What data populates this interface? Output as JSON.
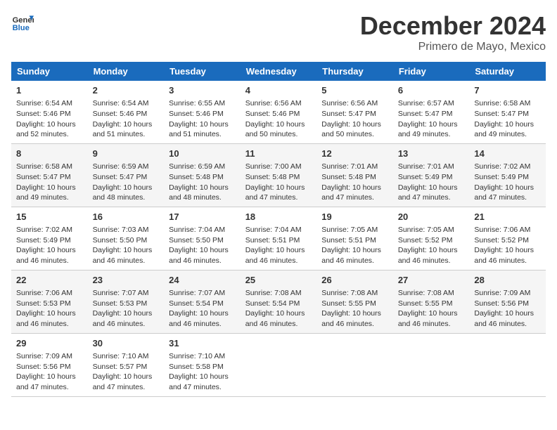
{
  "logo": {
    "line1": "General",
    "line2": "Blue"
  },
  "title": "December 2024",
  "location": "Primero de Mayo, Mexico",
  "headers": [
    "Sunday",
    "Monday",
    "Tuesday",
    "Wednesday",
    "Thursday",
    "Friday",
    "Saturday"
  ],
  "weeks": [
    [
      {
        "day": "1",
        "sunrise": "6:54 AM",
        "sunset": "5:46 PM",
        "daylight": "10 hours and 52 minutes."
      },
      {
        "day": "2",
        "sunrise": "6:54 AM",
        "sunset": "5:46 PM",
        "daylight": "10 hours and 51 minutes."
      },
      {
        "day": "3",
        "sunrise": "6:55 AM",
        "sunset": "5:46 PM",
        "daylight": "10 hours and 51 minutes."
      },
      {
        "day": "4",
        "sunrise": "6:56 AM",
        "sunset": "5:46 PM",
        "daylight": "10 hours and 50 minutes."
      },
      {
        "day": "5",
        "sunrise": "6:56 AM",
        "sunset": "5:47 PM",
        "daylight": "10 hours and 50 minutes."
      },
      {
        "day": "6",
        "sunrise": "6:57 AM",
        "sunset": "5:47 PM",
        "daylight": "10 hours and 49 minutes."
      },
      {
        "day": "7",
        "sunrise": "6:58 AM",
        "sunset": "5:47 PM",
        "daylight": "10 hours and 49 minutes."
      }
    ],
    [
      {
        "day": "8",
        "sunrise": "6:58 AM",
        "sunset": "5:47 PM",
        "daylight": "10 hours and 49 minutes."
      },
      {
        "day": "9",
        "sunrise": "6:59 AM",
        "sunset": "5:47 PM",
        "daylight": "10 hours and 48 minutes."
      },
      {
        "day": "10",
        "sunrise": "6:59 AM",
        "sunset": "5:48 PM",
        "daylight": "10 hours and 48 minutes."
      },
      {
        "day": "11",
        "sunrise": "7:00 AM",
        "sunset": "5:48 PM",
        "daylight": "10 hours and 47 minutes."
      },
      {
        "day": "12",
        "sunrise": "7:01 AM",
        "sunset": "5:48 PM",
        "daylight": "10 hours and 47 minutes."
      },
      {
        "day": "13",
        "sunrise": "7:01 AM",
        "sunset": "5:49 PM",
        "daylight": "10 hours and 47 minutes."
      },
      {
        "day": "14",
        "sunrise": "7:02 AM",
        "sunset": "5:49 PM",
        "daylight": "10 hours and 47 minutes."
      }
    ],
    [
      {
        "day": "15",
        "sunrise": "7:02 AM",
        "sunset": "5:49 PM",
        "daylight": "10 hours and 46 minutes."
      },
      {
        "day": "16",
        "sunrise": "7:03 AM",
        "sunset": "5:50 PM",
        "daylight": "10 hours and 46 minutes."
      },
      {
        "day": "17",
        "sunrise": "7:04 AM",
        "sunset": "5:50 PM",
        "daylight": "10 hours and 46 minutes."
      },
      {
        "day": "18",
        "sunrise": "7:04 AM",
        "sunset": "5:51 PM",
        "daylight": "10 hours and 46 minutes."
      },
      {
        "day": "19",
        "sunrise": "7:05 AM",
        "sunset": "5:51 PM",
        "daylight": "10 hours and 46 minutes."
      },
      {
        "day": "20",
        "sunrise": "7:05 AM",
        "sunset": "5:52 PM",
        "daylight": "10 hours and 46 minutes."
      },
      {
        "day": "21",
        "sunrise": "7:06 AM",
        "sunset": "5:52 PM",
        "daylight": "10 hours and 46 minutes."
      }
    ],
    [
      {
        "day": "22",
        "sunrise": "7:06 AM",
        "sunset": "5:53 PM",
        "daylight": "10 hours and 46 minutes."
      },
      {
        "day": "23",
        "sunrise": "7:07 AM",
        "sunset": "5:53 PM",
        "daylight": "10 hours and 46 minutes."
      },
      {
        "day": "24",
        "sunrise": "7:07 AM",
        "sunset": "5:54 PM",
        "daylight": "10 hours and 46 minutes."
      },
      {
        "day": "25",
        "sunrise": "7:08 AM",
        "sunset": "5:54 PM",
        "daylight": "10 hours and 46 minutes."
      },
      {
        "day": "26",
        "sunrise": "7:08 AM",
        "sunset": "5:55 PM",
        "daylight": "10 hours and 46 minutes."
      },
      {
        "day": "27",
        "sunrise": "7:08 AM",
        "sunset": "5:55 PM",
        "daylight": "10 hours and 46 minutes."
      },
      {
        "day": "28",
        "sunrise": "7:09 AM",
        "sunset": "5:56 PM",
        "daylight": "10 hours and 46 minutes."
      }
    ],
    [
      {
        "day": "29",
        "sunrise": "7:09 AM",
        "sunset": "5:56 PM",
        "daylight": "10 hours and 47 minutes."
      },
      {
        "day": "30",
        "sunrise": "7:10 AM",
        "sunset": "5:57 PM",
        "daylight": "10 hours and 47 minutes."
      },
      {
        "day": "31",
        "sunrise": "7:10 AM",
        "sunset": "5:58 PM",
        "daylight": "10 hours and 47 minutes."
      },
      null,
      null,
      null,
      null
    ]
  ],
  "labels": {
    "sunrise": "Sunrise:",
    "sunset": "Sunset:",
    "daylight": "Daylight:"
  }
}
